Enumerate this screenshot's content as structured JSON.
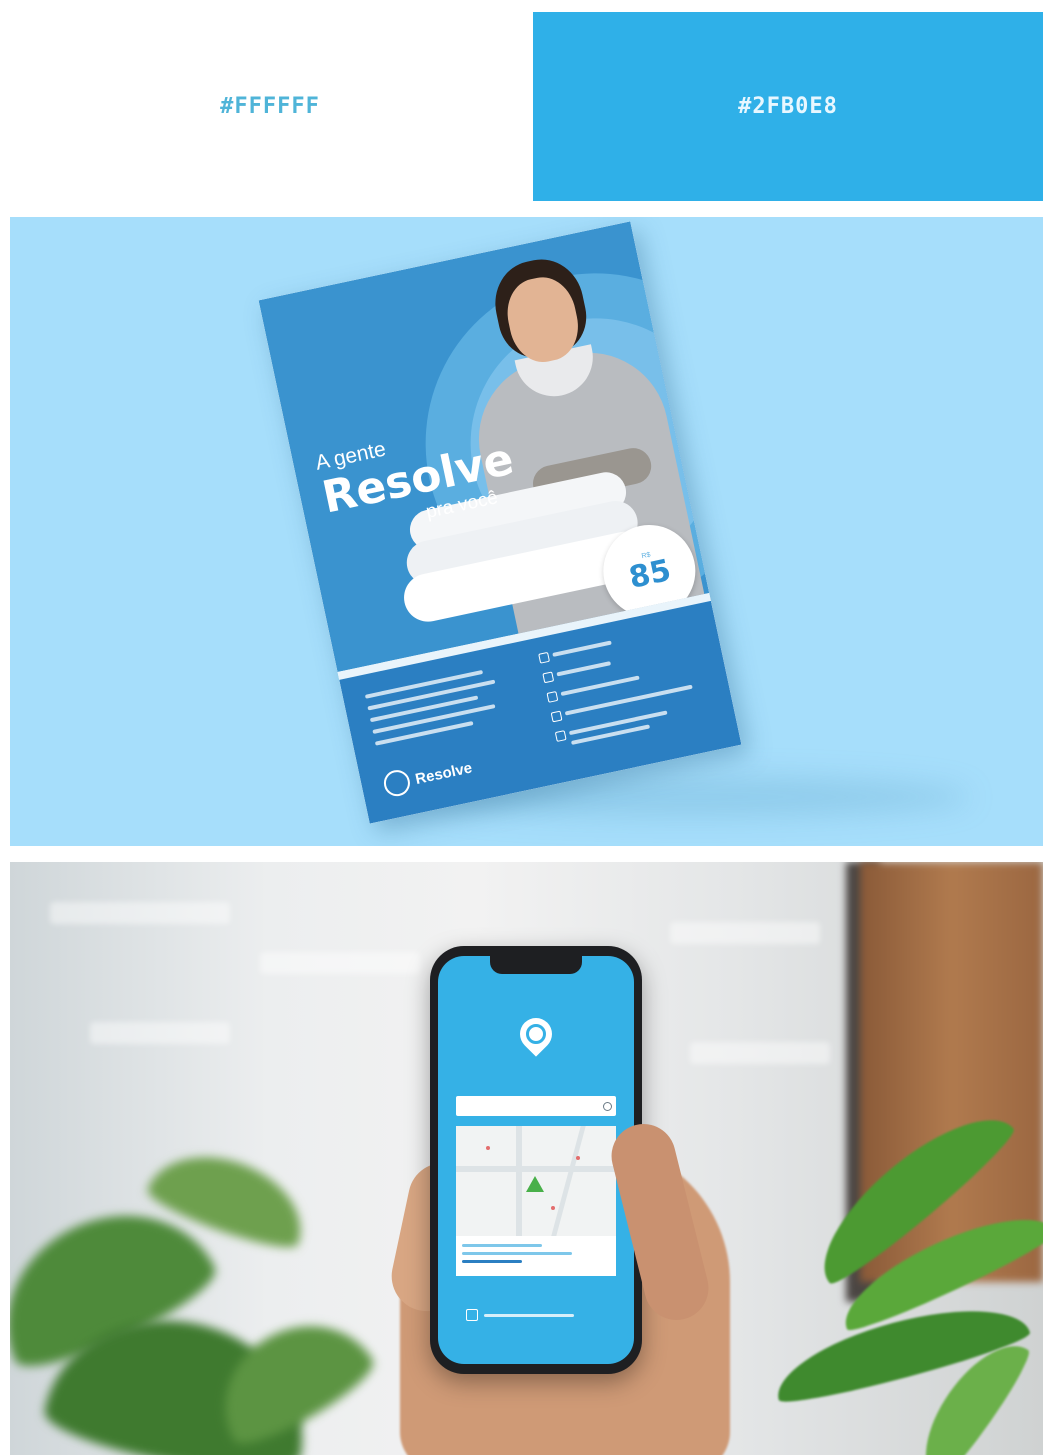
{
  "palette": {
    "white": {
      "label": "#FFFFFF",
      "hex": "#ffffff"
    },
    "blue": {
      "label": "#2FB0E8",
      "hex": "#2fb0e8"
    }
  },
  "flyer": {
    "headline_line1": "A gente",
    "headline_line2": "Resolve",
    "headline_line3": "pra você",
    "price_prefix": "R$",
    "price_value": "85",
    "brand": "Resolve",
    "colors": {
      "top": "#3a93cf",
      "bottom": "#2b7fc2",
      "background": "#a6defb"
    }
  },
  "app": {
    "brand_color": "#35b1e6",
    "map_pin_color": "#49b04a"
  }
}
